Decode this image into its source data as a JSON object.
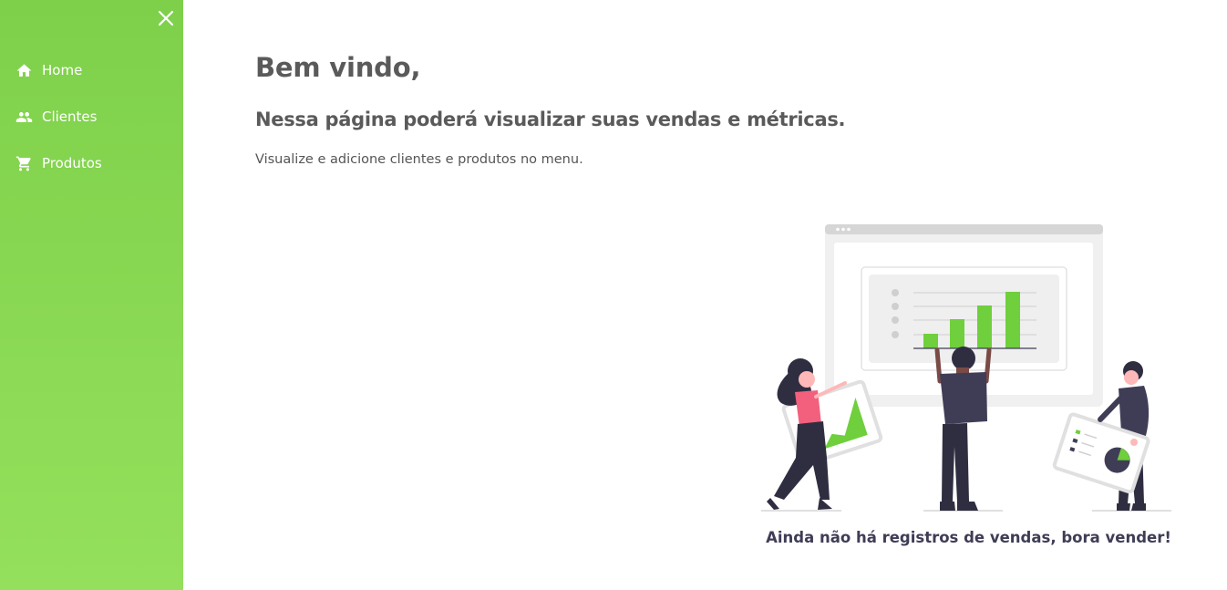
{
  "sidebar": {
    "items": [
      {
        "label": "Home",
        "icon": "home-icon"
      },
      {
        "label": "Clientes",
        "icon": "people-icon"
      },
      {
        "label": "Produtos",
        "icon": "cart-icon"
      }
    ],
    "close_icon": "close-icon"
  },
  "main": {
    "title": "Bem vindo,",
    "subtitle": "Nessa página poderá visualizar suas vendas e métricas.",
    "description": "Visualize e adicione clientes e produtos no menu.",
    "empty_message": "Ainda não há registros de vendas, bora vender!"
  },
  "colors": {
    "sidebar_top": "#7ed04a",
    "sidebar_bottom": "#94e05c",
    "accent": "#6fcf3d",
    "text": "#5a5a5a",
    "illustration_dark": "#3f3d56"
  }
}
